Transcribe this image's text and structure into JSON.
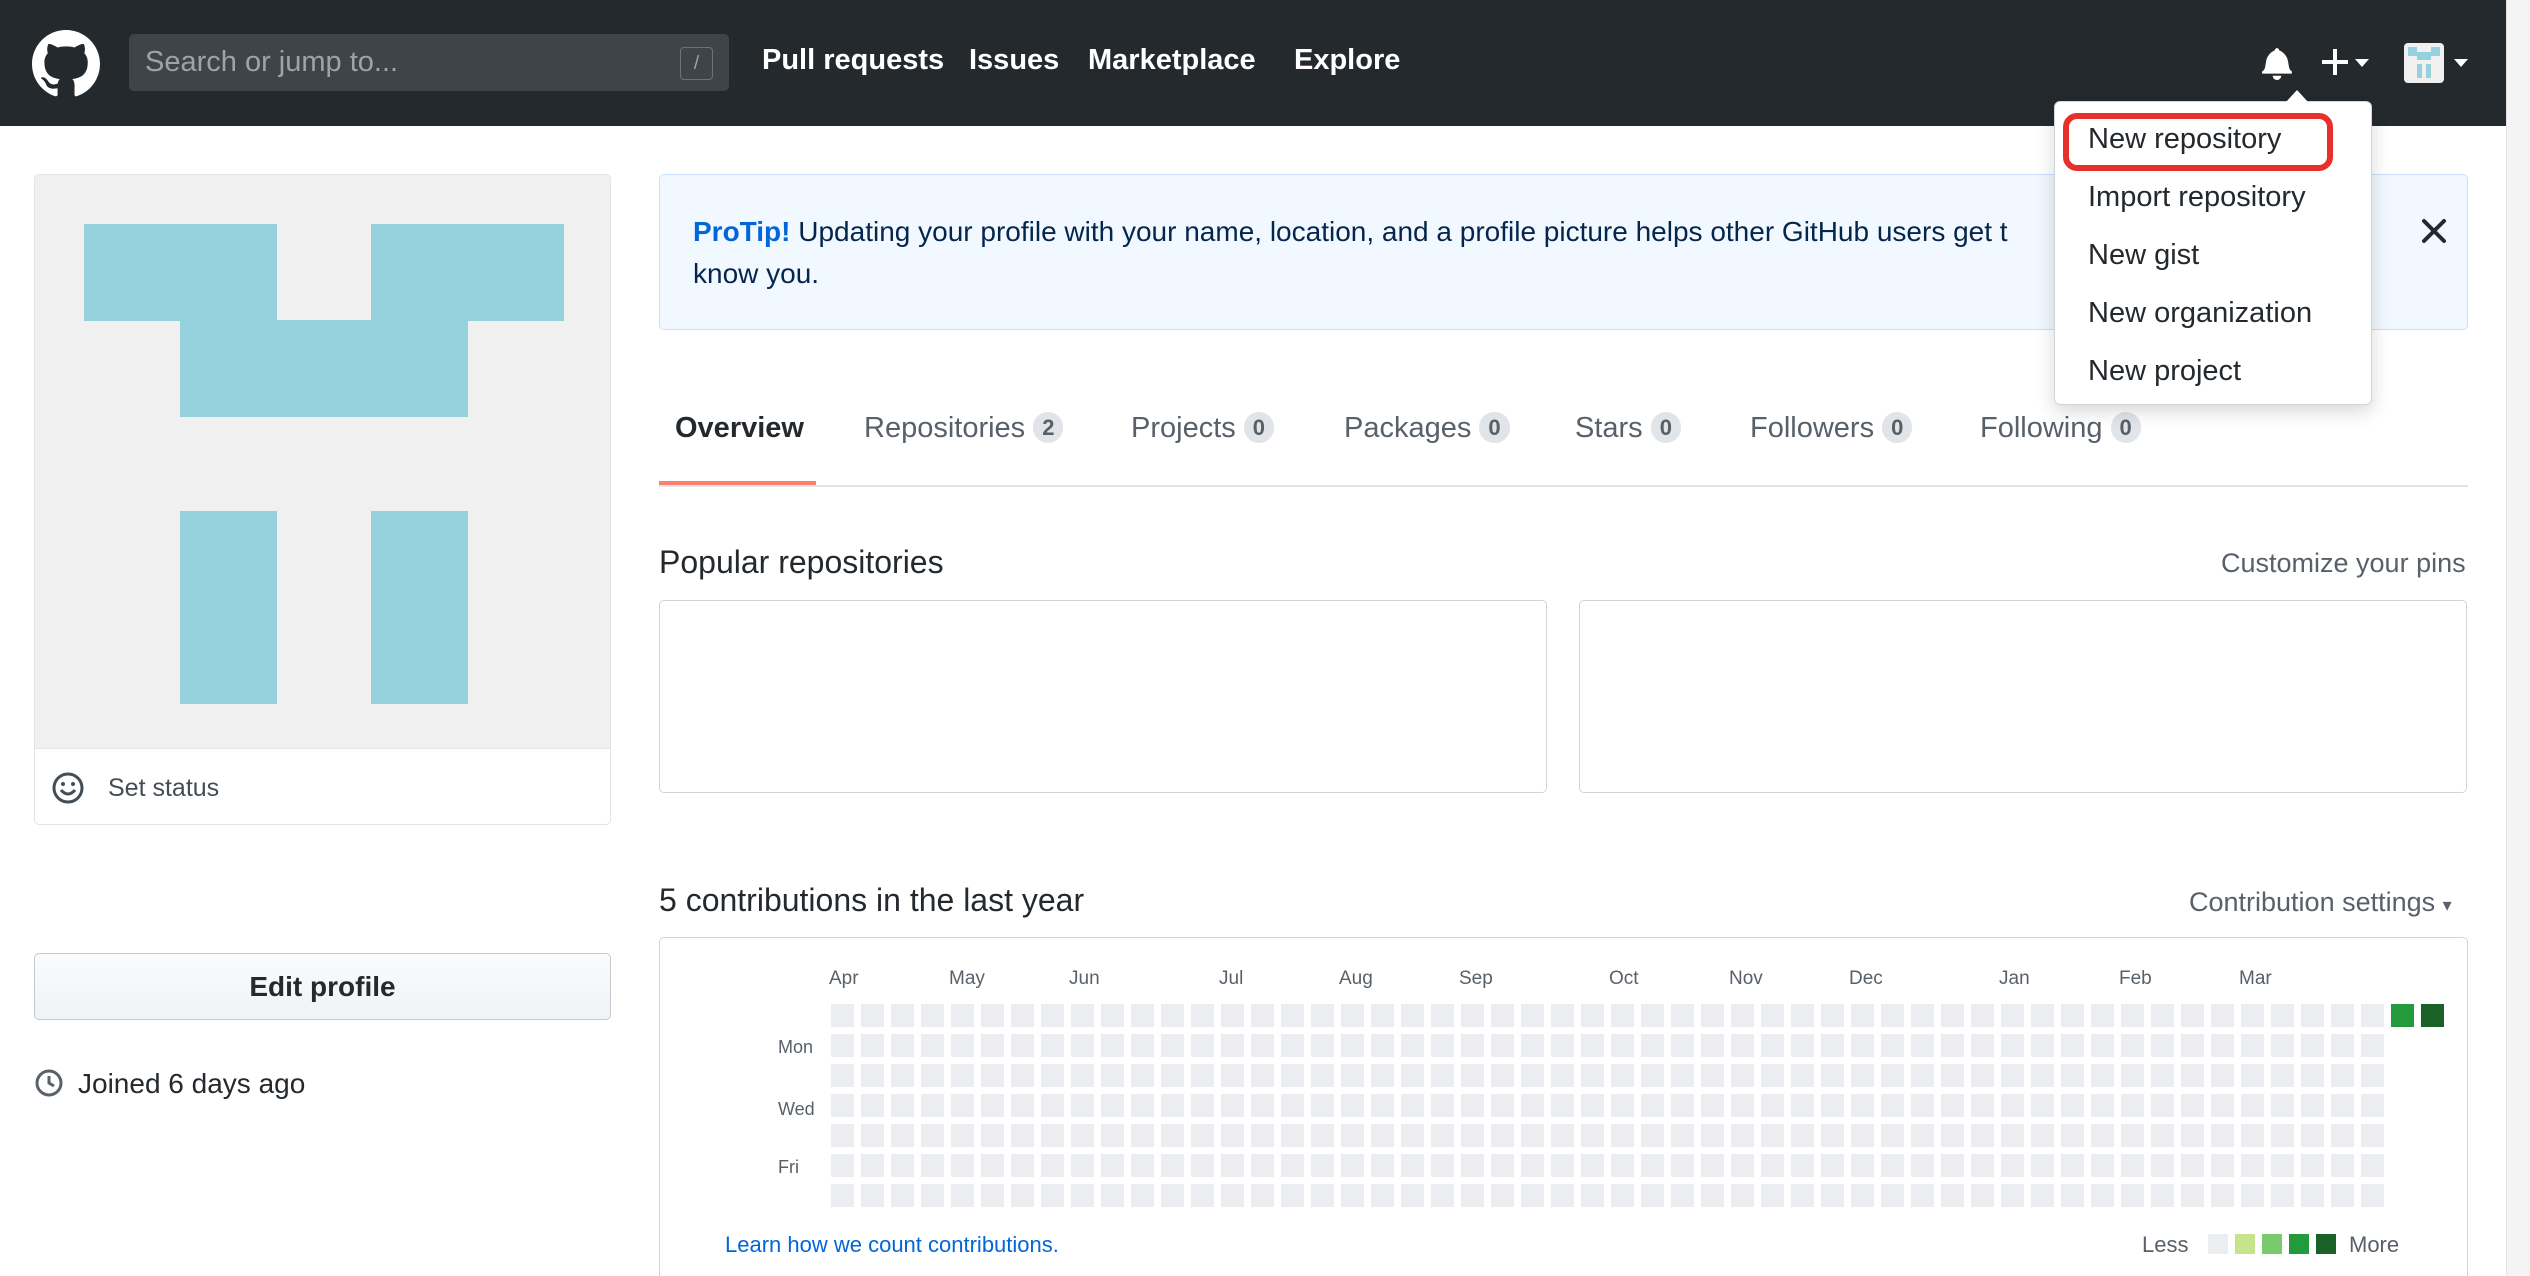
{
  "header": {
    "search_placeholder": "Search or jump to...",
    "search_key": "/",
    "nav": [
      "Pull requests",
      "Issues",
      "Marketplace",
      "Explore"
    ],
    "icons": [
      "github-logo-icon",
      "bell-icon",
      "plus-icon",
      "caret-down-icon",
      "avatar-icon"
    ]
  },
  "dropdown": {
    "items": [
      "New repository",
      "Import repository",
      "New gist",
      "New organization",
      "New project"
    ],
    "highlighted": "New repository",
    "highlight_color": "#e8302a"
  },
  "sidebar": {
    "set_status": "Set status",
    "edit_profile": "Edit profile",
    "joined": "Joined 6 days ago",
    "identicon_color": "#96d2de"
  },
  "protip": {
    "label": "ProTip!",
    "text": " Updating your profile with your name, location, and a profile picture helps other GitHub users get t",
    "text_line2": "know you."
  },
  "tabs": [
    {
      "label": "Overview",
      "count": null,
      "active": true
    },
    {
      "label": "Repositories",
      "count": "2"
    },
    {
      "label": "Projects",
      "count": "0"
    },
    {
      "label": "Packages",
      "count": "0"
    },
    {
      "label": "Stars",
      "count": "0"
    },
    {
      "label": "Followers",
      "count": "0"
    },
    {
      "label": "Following",
      "count": "0"
    }
  ],
  "popular": {
    "title": "Popular repositories",
    "customize": "Customize your pins"
  },
  "contributions": {
    "title": "5 contributions in the last year",
    "settings": "Contribution settings",
    "months": [
      "Apr",
      "May",
      "Jun",
      "Jul",
      "Aug",
      "Sep",
      "Oct",
      "Nov",
      "Dec",
      "Jan",
      "Feb",
      "Mar"
    ],
    "days": [
      "Mon",
      "Wed",
      "Fri"
    ],
    "learn": "Learn how we count contributions.",
    "less": "Less",
    "more": "More",
    "colors": [
      "#ebedf0",
      "#c6e48b",
      "#7bc96f",
      "#239a3b",
      "#196127"
    ],
    "active_days": [
      {
        "week": 52,
        "day": 0,
        "level": 3
      },
      {
        "week": 53,
        "day": 0,
        "level": 4
      }
    ]
  }
}
